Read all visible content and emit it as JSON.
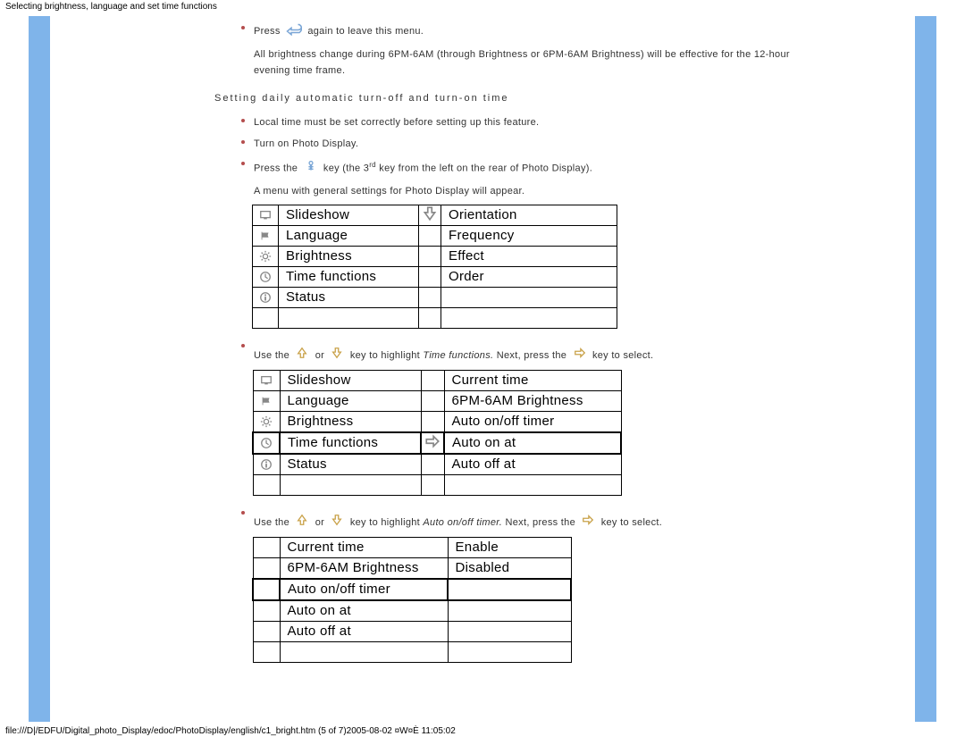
{
  "doc": {
    "header_title": "Selecting brightness, language and set time functions",
    "footer_path": "file:///D|/EDFU/Digital_photo_Display/edoc/PhotoDisplay/english/c1_bright.htm (5 of 7)2005-08-02 ¤W¤È 11:05:02"
  },
  "text": {
    "press": "Press",
    "again_leave": " again to leave this menu.",
    "brightness_note": "All brightness change during 6PM-6AM (through Brightness or 6PM-6AM Brightness) will be effective for the 12-hour evening time frame.",
    "section_title": "Setting daily automatic turn-off and turn-on time",
    "local_time": "Local time must be set correctly before setting up this feature.",
    "turn_on": "Turn on Photo Display.",
    "press_the": "Press the ",
    "key_desc_a": " key (the 3",
    "rd": "rd",
    "key_desc_b": " key from the left on the rear of Photo Display).",
    "menu_appear": "A menu with general settings for Photo Display will appear.",
    "use_the": "Use the ",
    "or": " or ",
    "highlight_tf_a": " key to highlight ",
    "time_functions_italic": "Time functions.",
    "highlight_tf_b": " Next, press the ",
    "to_select": " key to select.",
    "auto_timer_italic": "Auto on/off timer."
  },
  "menu1": {
    "left": [
      "Slideshow",
      "Language",
      "Brightness",
      "Time functions",
      "Status"
    ],
    "right": [
      "Orientation",
      "Frequency",
      "Effect",
      "Order"
    ],
    "arrow_row": 0
  },
  "menu2": {
    "left": [
      "Slideshow",
      "Language",
      "Brightness",
      "Time functions",
      "Status"
    ],
    "right": [
      "Current time",
      "6PM-6AM Brightness",
      "Auto on/off timer",
      "Auto on at",
      "Auto off at"
    ],
    "highlight_row": 3
  },
  "menu3": {
    "left": [
      "Current time",
      "6PM-6AM Brightness",
      "Auto on/off timer",
      "Auto on at",
      "Auto off at"
    ],
    "right": [
      "Enable",
      "Disabled"
    ],
    "highlight_row": 2
  },
  "icons": {
    "back": "back-arrow-icon",
    "tool": "tool-key-icon",
    "up": "up-arrow-icon",
    "down": "down-arrow-icon",
    "right": "right-arrow-icon"
  }
}
